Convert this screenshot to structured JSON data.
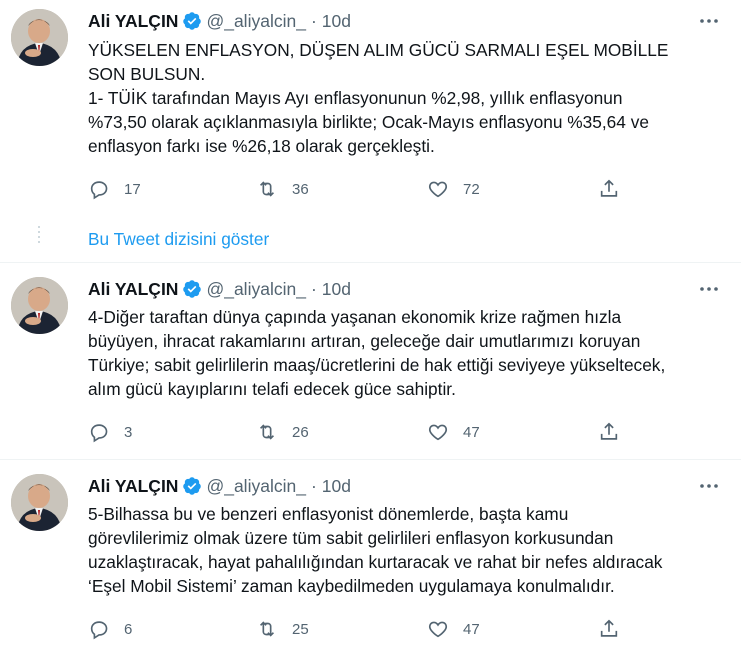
{
  "colors": {
    "accent": "#1d9bf0",
    "text": "#0f1419",
    "muted": "#536471",
    "verified": "#1d9bf0"
  },
  "show_thread_label": "Bu Tweet dizisini göster",
  "tweets": [
    {
      "author": "Ali YALÇIN",
      "handle": "@_aliyalcin_",
      "separator": "·",
      "time": "10d",
      "text": "YÜKSELEN ENFLASYON, DÜŞEN ALIM GÜCÜ SARMALI EŞEL MOBİLLE\nSON BULSUN.\n1- TÜİK tarafından Mayıs Ayı enflasyonunun %2,98, yıllık enflasyonun\n%73,50 olarak açıklanmasıyla birlikte; Ocak-Mayıs enflasyonu %35,64 ve\nenflasyon farkı ise %26,18 olarak gerçekleşti.",
      "replies": "17",
      "retweets": "36",
      "likes": "72"
    },
    {
      "author": "Ali YALÇIN",
      "handle": "@_aliyalcin_",
      "separator": "·",
      "time": "10d",
      "text": "4-Diğer taraftan dünya çapında yaşanan ekonomik krize rağmen hızla\nbüyüyen, ihracat rakamlarını artıran, geleceğe dair umutlarımızı koruyan\nTürkiye; sabit gelirlilerin maaş/ücretlerini de hak ettiği seviyeye yükseltecek,\nalım gücü kayıplarını telafi edecek güce sahiptir.",
      "replies": "3",
      "retweets": "26",
      "likes": "47"
    },
    {
      "author": "Ali YALÇIN",
      "handle": "@_aliyalcin_",
      "separator": "·",
      "time": "10d",
      "text": "5-Bilhassa bu ve benzeri enflasyonist dönemlerde, başta kamu\ngörevlilerimiz olmak üzere tüm sabit gelirlileri enflasyon korkusundan\nuzaklaştıracak, hayat pahalılığından kurtaracak ve rahat bir nefes aldıracak\n‘Eşel Mobil Sistemi’ zaman kaybedilmeden uygulamaya konulmalıdır.",
      "replies": "6",
      "retweets": "25",
      "likes": "47"
    }
  ]
}
